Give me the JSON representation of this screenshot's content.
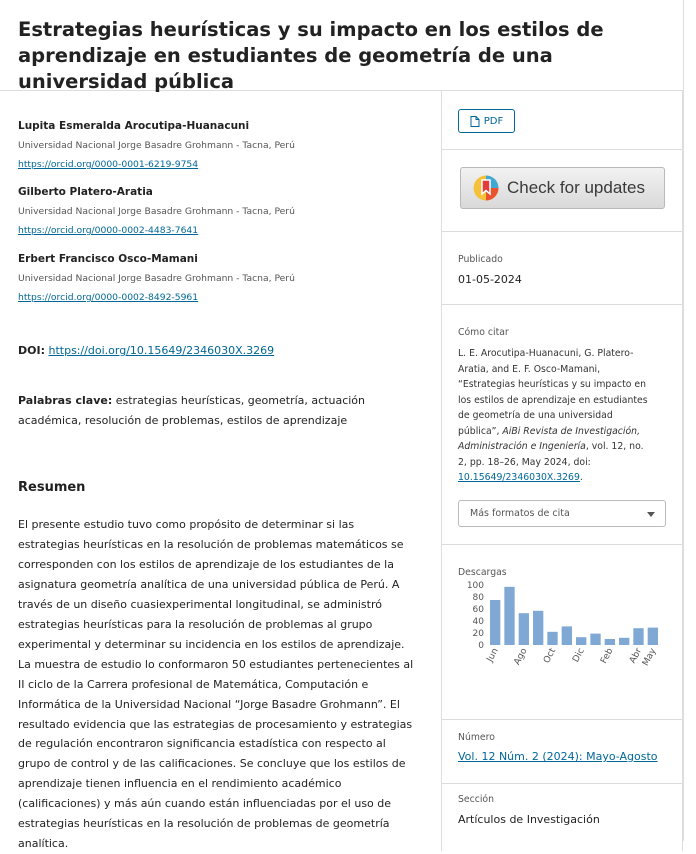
{
  "article": {
    "title": "Estrategias heurísticas y su impacto en los estilos de aprendizaje en estudiantes de geometría de una universidad pública",
    "authors": [
      {
        "name": "Lupita Esmeralda Arocutipa-Huanacuni",
        "affiliation": "Universidad Nacional Jorge Basadre Grohmann - Tacna, Perú",
        "orcid": "https://orcid.org/0000-0001-6219-9754"
      },
      {
        "name": "Gilberto Platero-Aratia",
        "affiliation": "Universidad Nacional Jorge Basadre Grohmann - Tacna, Perú",
        "orcid": "https://orcid.org/0000-0002-4483-7641"
      },
      {
        "name": "Erbert Francisco Osco-Mamani",
        "affiliation": "Universidad Nacional Jorge Basadre Grohmann - Tacna, Perú",
        "orcid": "https://orcid.org/0000-0002-8492-5961"
      }
    ],
    "doi_label": "DOI:",
    "doi": "https://doi.org/10.15649/2346030X.3269",
    "keywords_label": "Palabras clave:",
    "keywords": "estrategias heurísticas, geometría, actuación académica, resolución de problemas, estilos de aprendizaje",
    "abstract_heading": "Resumen",
    "abstract": "El presente estudio tuvo como propósito de determinar si las estrategias heurísticas en la resolución de problemas matemáticos se corresponden con los estilos de aprendizaje de los estudiantes de la asignatura geometría analítica de una universidad pública de Perú. A través de un diseño cuasiexperimental longitudinal, se administró estrategias heurísticas para la resolución de problemas al grupo experimental y determinar su incidencia en los estilos de aprendizaje. La muestra de estudio lo conformaron 50 estudiantes pertenecientes al II ciclo de la Carrera profesional de Matemática, Computación e Informática de la Universidad Nacional “Jorge Basadre Grohmann”. El resultado evidencia que las estrategias de procesamiento y estrategias de regulación encontraron significancia estadística con respecto al grupo de control y de las calificaciones. Se concluye que los estilos de aprendizaje tienen influencia en el rendimiento académico (calificaciones) y más aún cuando están influenciadas por el uso de estrategias heurísticas en la resolución de problemas de geometría analítica."
  },
  "sidebar": {
    "pdf_label": "PDF",
    "check_updates_label": "Check for updates",
    "published_label": "Publicado",
    "published_date": "01-05-2024",
    "cite_label": "Cómo citar",
    "citation": {
      "authors": "L. E. Arocutipa-Huanacuni, G. Platero-Aratia, and E. F. Osco-Mamani, “Estrategias heurísticas y su impacto en los estilos de aprendizaje en estudiantes de geometría de una universidad pública”,",
      "journal": "AiBi Revista de Investigación, Administración e Ingeniería",
      "details": ", vol. 12, no. 2, pp. 18–26, May 2024, doi:",
      "doi": "10.15649/2346030X.3269",
      "end": "."
    },
    "cite_formats_label": "Más formatos de cita",
    "downloads_label": "Descargas",
    "issue_label": "Número",
    "issue_value": "Vol. 12 Núm. 2 (2024): Mayo-Agosto",
    "section_label": "Sección",
    "section_value": "Artículos de Investigación"
  },
  "colors": {
    "link": "#006798",
    "bar": "#7fa9d4",
    "border": "#dddddd"
  },
  "chart_data": {
    "type": "bar",
    "title": "Descargas",
    "categories": [
      "Jun",
      "Jul",
      "Ago",
      "Sep",
      "Oct",
      "Nov",
      "Dic",
      "Ene",
      "Feb",
      "Mar",
      "Abr",
      "May"
    ],
    "tick_labels": [
      "Jun",
      "Ago",
      "Oct",
      "Dic",
      "Feb",
      "Abr",
      "May"
    ],
    "values": [
      75,
      97,
      53,
      57,
      22,
      31,
      13,
      19,
      10,
      12,
      28,
      29
    ],
    "y_ticks": [
      0,
      20,
      40,
      60,
      80,
      100
    ],
    "ylim": [
      0,
      100
    ],
    "grid": false,
    "legend": "none"
  }
}
